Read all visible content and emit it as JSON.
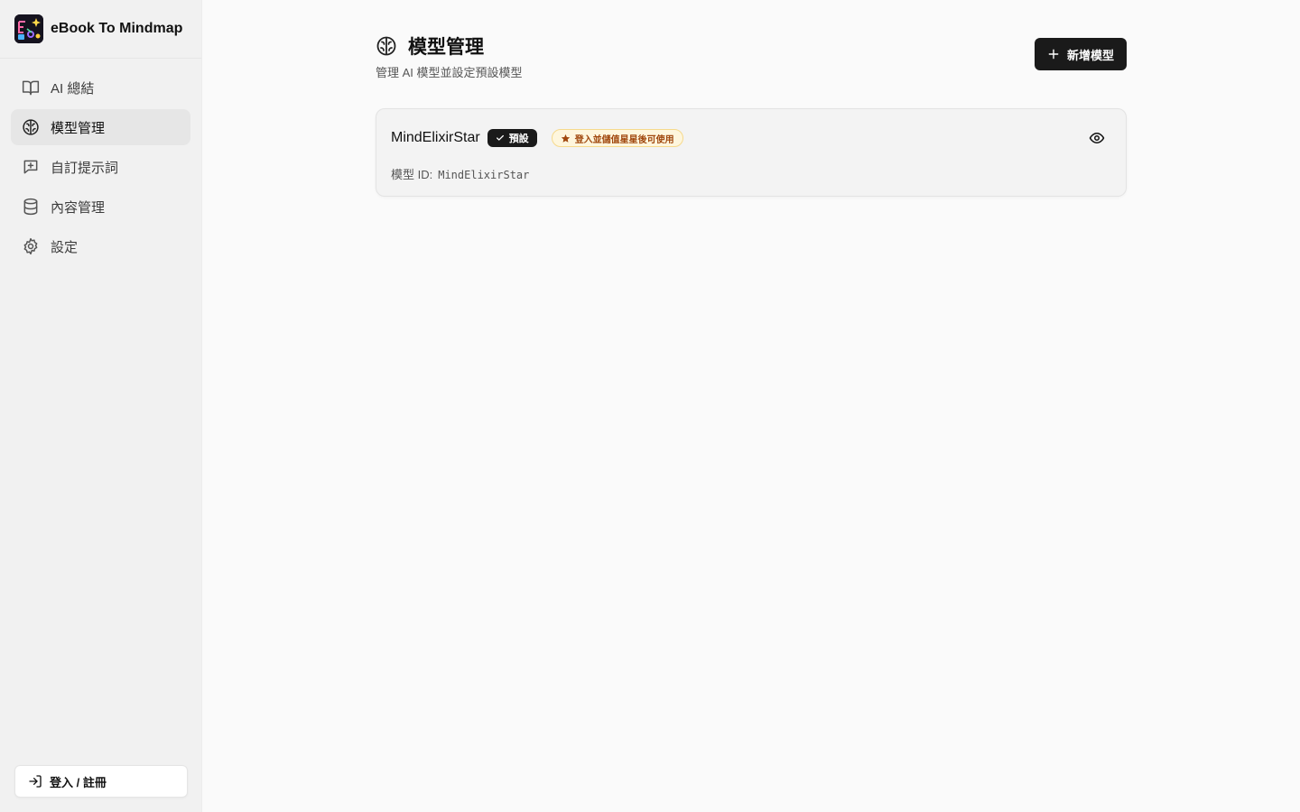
{
  "app": {
    "title": "eBook To Mindmap"
  },
  "sidebar": {
    "items": [
      {
        "label": "AI 總結",
        "icon": "book-open-icon"
      },
      {
        "label": "模型管理",
        "icon": "brain-icon",
        "active": true
      },
      {
        "label": "自訂提示詞",
        "icon": "message-plus-icon"
      },
      {
        "label": "內容管理",
        "icon": "database-icon"
      },
      {
        "label": "設定",
        "icon": "gear-icon"
      }
    ],
    "login_label": "登入 / 註冊"
  },
  "header": {
    "title": "模型管理",
    "subtitle": "管理 AI 模型並設定預設模型",
    "add_label": "新增模型"
  },
  "models": [
    {
      "name": "MindElixirStar",
      "default_label": "預設",
      "notice": "登入並儲值星星後可使用",
      "id_label": "模型 ID:",
      "id_value": "MindElixirStar"
    }
  ],
  "colors": {
    "accent": "#1a1a1a",
    "sidebar_bg": "#f1f1f1",
    "notice_bg": "#fef6dd",
    "notice_text": "#a0470d"
  }
}
